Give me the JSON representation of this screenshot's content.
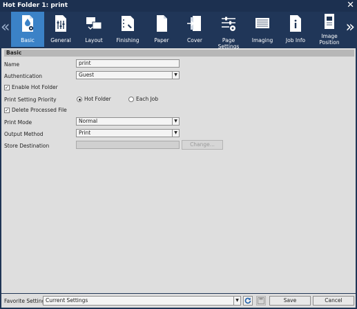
{
  "window": {
    "title": "Hot Folder 1: print"
  },
  "tabs": [
    {
      "label": "Basic",
      "icon": "basic-settings-icon"
    },
    {
      "label": "General",
      "icon": "general-settings-icon"
    },
    {
      "label": "Layout",
      "icon": "layout-icon"
    },
    {
      "label": "Finishing",
      "icon": "finishing-icon"
    },
    {
      "label": "Paper",
      "icon": "paper-icon"
    },
    {
      "label": "Cover",
      "icon": "cover-icon"
    },
    {
      "label": "Page Settings",
      "icon": "page-settings-icon"
    },
    {
      "label": "Imaging",
      "icon": "imaging-icon"
    },
    {
      "label": "Job Info",
      "icon": "job-info-icon"
    },
    {
      "label": "Image Position",
      "icon": "image-position-icon"
    }
  ],
  "section": {
    "title": "Basic"
  },
  "form": {
    "name_label": "Name",
    "name_value": "print",
    "auth_label": "Authentication",
    "auth_value": "Guest",
    "enable_hot_folder_label": "Enable Hot Folder",
    "priority_label": "Print Setting Priority",
    "priority_options": [
      "Hot Folder",
      "Each Job"
    ],
    "delete_processed_label": "Delete Processed File",
    "print_mode_label": "Print Mode",
    "print_mode_value": "Normal",
    "output_method_label": "Output Method",
    "output_method_value": "Print",
    "store_destination_label": "Store Destination",
    "store_destination_value": "",
    "change_button": "Change..."
  },
  "footer": {
    "favorite_label": "Favorite Setting",
    "favorite_value": "Current Settings",
    "save_button": "Save",
    "cancel_button": "Cancel"
  },
  "colors": {
    "titlebar": "#1c3050",
    "tab_bar": "#203658",
    "active_tab": "#3b82c7",
    "panel": "#dedede"
  }
}
